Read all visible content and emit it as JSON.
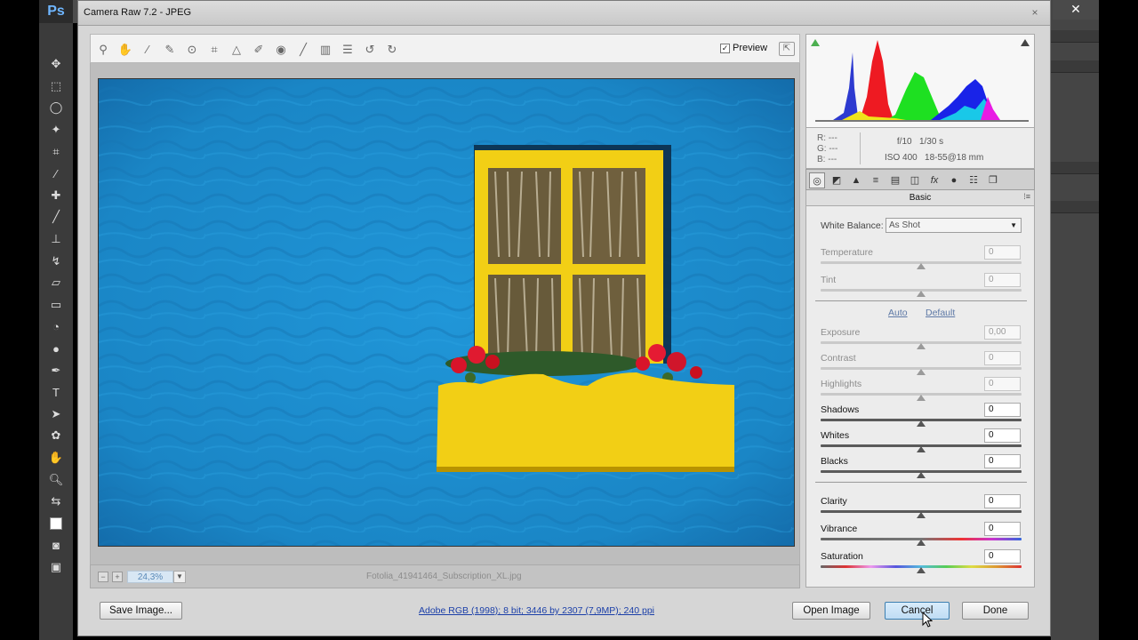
{
  "app": {
    "photoshop_logo": "Ps"
  },
  "dialog": {
    "title": "Camera Raw 7.2  -  JPEG",
    "close_glyph": "×"
  },
  "toolbar": {
    "tools": [
      "zoom-tool",
      "hand-tool",
      "white-balance-tool",
      "color-sampler-tool",
      "targeted-adjustment-tool",
      "crop-tool",
      "straighten-tool",
      "spot-removal-tool",
      "red-eye-removal-tool",
      "adjustment-brush-tool",
      "graduated-filter-tool",
      "preferences",
      "rotate-ccw",
      "rotate-cw"
    ],
    "preview_label": "Preview",
    "preview_checked": true
  },
  "canvas": {
    "filename": "Fotolia_41941464_Subscription_XL.jpg",
    "zoom": "24,3%"
  },
  "histogram": {
    "rgb": {
      "r_label": "R:",
      "g_label": "G:",
      "b_label": "B:",
      "r": "---",
      "g": "---",
      "b": "---"
    },
    "aperture": "f/10",
    "shutter": "1/30 s",
    "iso": "ISO 400",
    "lens": "18-55@18 mm"
  },
  "panel": {
    "tabs": [
      "basic",
      "tone-curve",
      "detail",
      "hsl-grayscale",
      "split-toning",
      "lens-corrections",
      "effects",
      "camera-calibration",
      "presets",
      "snapshots"
    ],
    "title": "Basic",
    "white_balance_label": "White Balance:",
    "white_balance_value": "As Shot",
    "auto_label": "Auto",
    "default_label": "Default",
    "sliders": [
      {
        "label": "Temperature",
        "value": "0",
        "enabled": false,
        "level": 0.5
      },
      {
        "label": "Tint",
        "value": "0",
        "enabled": false,
        "level": 0.5
      },
      {
        "label": "Exposure",
        "value": "0,00",
        "enabled": false,
        "level": 0.5
      },
      {
        "label": "Contrast",
        "value": "0",
        "enabled": false,
        "level": 0.5
      },
      {
        "label": "Highlights",
        "value": "0",
        "enabled": false,
        "level": 0.5
      },
      {
        "label": "Shadows",
        "value": "0",
        "enabled": true,
        "level": 0.5
      },
      {
        "label": "Whites",
        "value": "0",
        "enabled": true,
        "level": 0.5
      },
      {
        "label": "Blacks",
        "value": "0",
        "enabled": true,
        "level": 0.5
      },
      {
        "label": "Clarity",
        "value": "0",
        "enabled": true,
        "level": 0.5
      },
      {
        "label": "Vibrance",
        "value": "0",
        "enabled": true,
        "level": 0.5
      },
      {
        "label": "Saturation",
        "value": "0",
        "enabled": true,
        "level": 0.5
      }
    ]
  },
  "footer": {
    "save_image": "Save Image...",
    "workflow": "Adobe RGB (1998); 8 bit; 3446 by 2307 (7,9MP); 240 ppi",
    "open_image": "Open Image",
    "cancel": "Cancel",
    "done": "Done"
  },
  "colors": {
    "wall": "#1e8fd0",
    "frame": "#f2cf15",
    "accent": "#3c7fb1"
  }
}
